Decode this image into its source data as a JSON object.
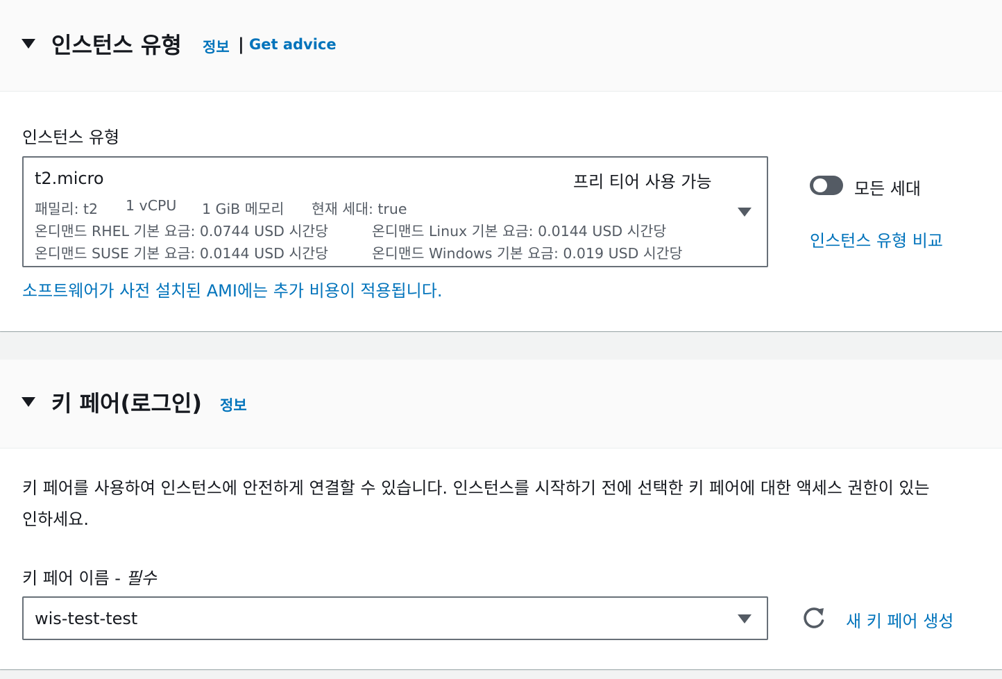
{
  "instance_type_section": {
    "title": "인스턴스 유형",
    "info_link": "정보",
    "separator": "|",
    "advice_link": "Get advice",
    "field_label": "인스턴스 유형",
    "selected": {
      "name": "t2.micro",
      "badge": "프리 티어 사용 가능",
      "family": "패밀리: t2",
      "vcpu": "1 vCPU",
      "memory": "1 GiB 메모리",
      "current_gen": "현재 세대: true",
      "rhel_price": "온디맨드 RHEL 기본 요금: 0.0744 USD 시간당",
      "linux_price": "온디맨드 Linux 기본 요금: 0.0144 USD 시간당",
      "suse_price": "온디맨드 SUSE 기본 요금: 0.0144 USD 시간당",
      "windows_price": "온디맨드 Windows 기본 요금: 0.019 USD 시간당"
    },
    "all_generations_toggle": {
      "label": "모든 세대",
      "on": false
    },
    "compare_link": "인스턴스 유형 비교",
    "ami_note": "소프트웨어가 사전 설치된 AMI에는 추가 비용이 적용됩니다."
  },
  "key_pair_section": {
    "title": "키 페어(로그인)",
    "info_link": "정보",
    "description_line1": "키 페어를 사용하여 인스턴스에 안전하게 연결할 수 있습니다. 인스턴스를 시작하기 전에 선택한 키 페어에 대한 액세스 권한이 있는",
    "description_line2": "인하세요.",
    "field_label": "키 페어 이름 - ",
    "field_required": "필수",
    "selected_value": "wis-test-test",
    "create_link": "새 키 페어 생성"
  },
  "colors": {
    "link": "#0073bb",
    "text": "#16191f",
    "secondary_text": "#545b64",
    "border": "#687078",
    "page_bg": "#f2f3f3"
  },
  "icons": [
    "caret-down-icon",
    "refresh-icon",
    "toggle-switch"
  ]
}
